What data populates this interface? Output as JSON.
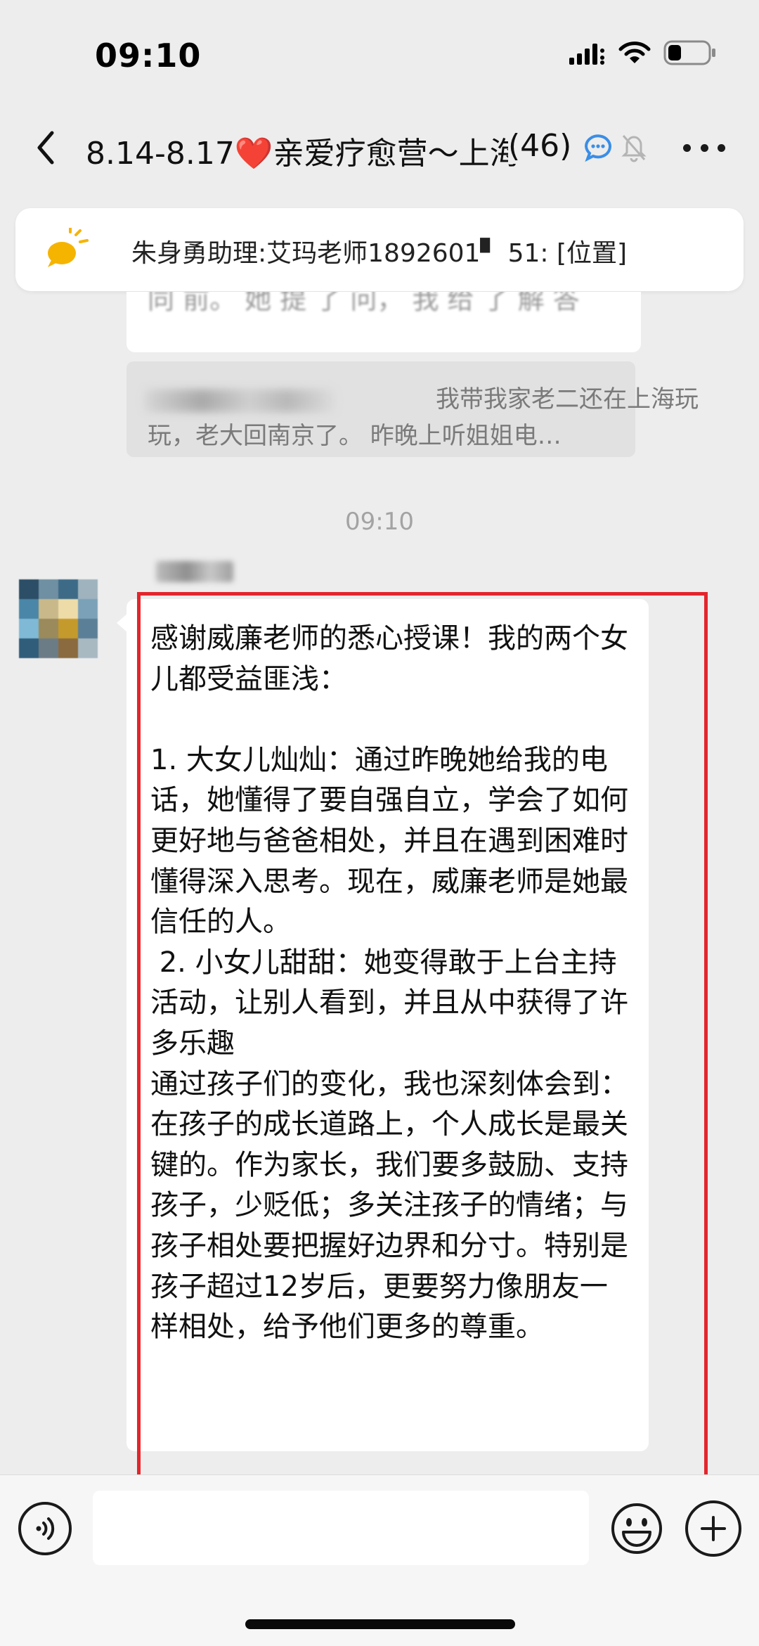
{
  "status_bar": {
    "time": "09:10"
  },
  "nav": {
    "title_prefix": "8.14-8.17",
    "title_heart": "❤️",
    "title_suffix": "亲爱疗愈营～上海",
    "member_count": "(46)"
  },
  "pinned": {
    "text": "朱身勇助理:艾玛老师1892601▘ 51: [位置]"
  },
  "chat": {
    "partial_bubble_text": "同 前。 她 提 了 问， 我 给 了 解 答",
    "quote_line1": "我带我家老二还在上海玩",
    "quote_line2": "玩，老大回南京了。 昨晚上听姐姐电…",
    "timestamp": "09:10",
    "message": "感谢威廉老师的悉心授课！我的两个女儿都受益匪浅：\n\n1. 大女儿灿灿：通过昨晚她给我的电话，她懂得了要自强自立，学会了如何更好地与爸爸相处，并且在遇到困难时懂得深入思考。现在，威廉老师是她最信任的人。\n 2. 小女儿甜甜：她变得敢于上台主持活动，让别人看到，并且从中获得了许多乐趣\n通过孩子们的变化，我也深刻体会到：在孩子的成长道路上，个人成长是最关键的。作为家长，我们要多鼓励、支持孩子，少贬低；多关注孩子的情绪；与孩子相处要把握好边界和分寸。特别是孩子超过12岁后，更要努力像朋友一样相处，给予他们更多的尊重。"
  },
  "colors": {
    "highlight": "#e2262c",
    "heart": "#e8252d",
    "accent_blue": "#3a8ee6",
    "background": "#ededed"
  },
  "icons": [
    "signal-icon",
    "wifi-icon",
    "battery-icon",
    "back-icon",
    "chat-bubble-icon",
    "mute-bell-icon",
    "more-icon",
    "announcement-icon",
    "voice-icon",
    "emoji-icon",
    "plus-icon"
  ]
}
